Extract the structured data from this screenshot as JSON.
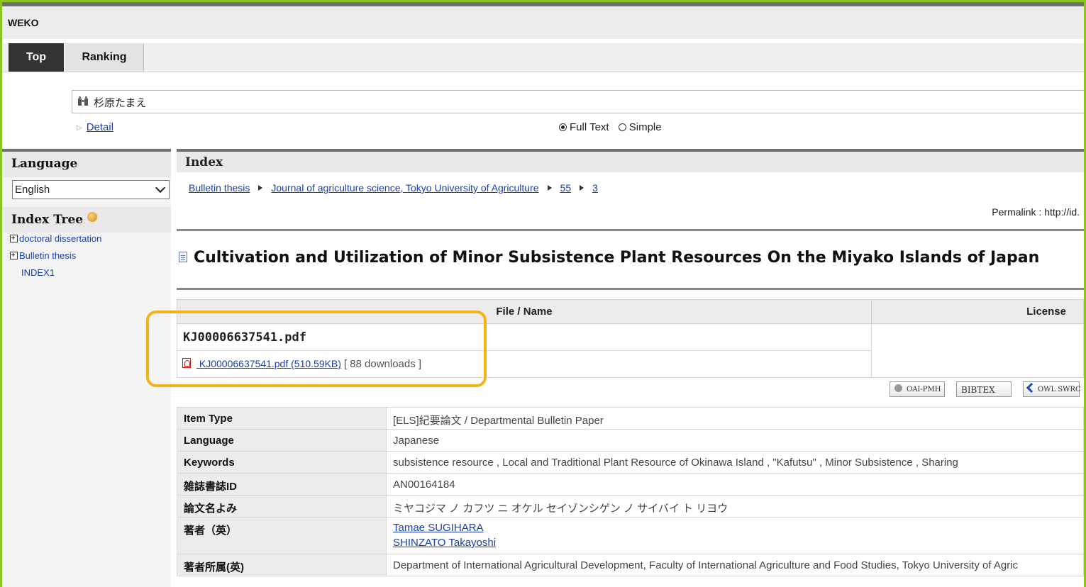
{
  "app": {
    "title": "WEKO"
  },
  "nav": {
    "tabs": [
      {
        "label": "Top"
      },
      {
        "label": "Ranking"
      }
    ]
  },
  "search": {
    "value": "杉原たまえ",
    "detail_label": "Detail",
    "mode_full": "Full Text",
    "mode_simple": "Simple"
  },
  "sidebar": {
    "language_header": "Language",
    "language_value": "English",
    "index_tree_header": "Index Tree",
    "tree_items": [
      "doctoral dissertation",
      "Bulletin thesis",
      "INDEX1"
    ]
  },
  "main": {
    "index_header": "Index",
    "breadcrumb": [
      "Bulletin thesis",
      "Journal of agriculture science, Tokyo University of Agriculture",
      "55",
      "3"
    ],
    "permalink": "Permalink : http://id.",
    "title": "Cultivation and Utilization of Minor Subsistence Plant Resources On the Miyako Islands of Japan",
    "files_table": {
      "col_file": "File / Name",
      "col_license": "License",
      "file_name": "KJ00006637541.pdf",
      "file_link": " KJ00006637541.pdf  (510.59KB)",
      "downloads": "[ 88 downloads ]"
    },
    "export_badges": {
      "oai": "OAI-PMH",
      "bibtex": "BIBTEX",
      "owl": "OWL SWRC"
    },
    "metadata": [
      {
        "key": "Item Type",
        "value": "[ELS]紀要論文 / Departmental Bulletin Paper"
      },
      {
        "key": "Language",
        "value": "Japanese"
      },
      {
        "key": "Keywords",
        "value": "subsistence resource , Local and Traditional Plant Resource of Okinawa Island , \"Kafutsu\" , Minor Subsistence , Sharing"
      },
      {
        "key": "雑誌書誌ID",
        "value": "AN00164184"
      },
      {
        "key": "論文名よみ",
        "value": "ミヤコジマ ノ カフツ ニ オケル セイゾンシゲン ノ サイバイ ト リヨウ"
      }
    ],
    "authors_key": "著者（英）",
    "authors": [
      "Tamae SUGIHARA",
      "SHINZATO Takayoshi"
    ],
    "affiliation_key": "著者所属(英)",
    "affiliation": "Department of International Agricultural Development, Faculty of International Agriculture and Food Studies, Tokyo University of Agric"
  },
  "colors": {
    "frame": "#8cc71f",
    "highlight": "#f3b21a",
    "link": "#1a3faa",
    "tab_active": "#333333"
  }
}
